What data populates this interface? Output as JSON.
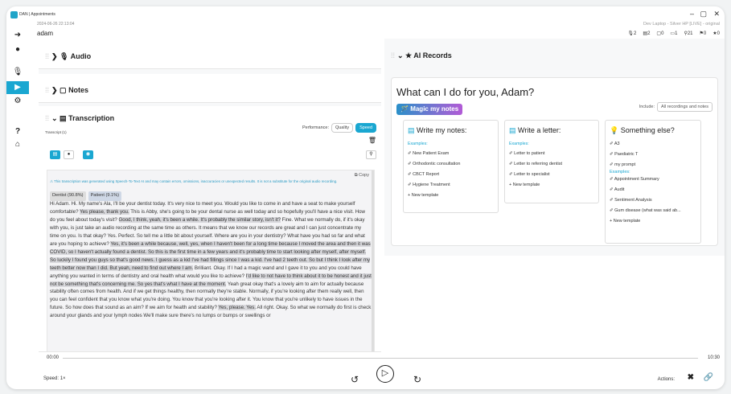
{
  "window": {
    "app_title": "DAN | Appointments",
    "date": "2024-06-26 22:13:04",
    "patient_name": "adam",
    "device": "Dev Laptop - Silver HP [LIVE] - original",
    "controls": {
      "minimize": "–",
      "maximize": "▢",
      "close": "✕"
    },
    "stats": [
      "2",
      "2",
      "0",
      "1",
      "21",
      "0",
      "0"
    ]
  },
  "nav": {
    "icons": [
      "arrow-icon",
      "person-icon",
      "mic-icon",
      "play-icon",
      "settings-icon",
      "help-icon",
      "home-icon"
    ]
  },
  "left": {
    "audio_label": "Audio",
    "notes_label": "Notes",
    "transcription_label": "Transcription",
    "transcript_sub": "Transcript (1)",
    "performance": {
      "label": "Performance:",
      "options": [
        "Quality",
        "Speed"
      ],
      "selected": "Speed"
    },
    "copy_label": "Copy",
    "warning": "This transcription was generated using Speech-To-Text AI and may contain errors, omissions, inaccuracies or unexpected results. It is not a substitute for the original audio recording.",
    "speakers": [
      "Dentist (90.8%)",
      "Patient (9.1%)"
    ],
    "transcript_text_pre": "Hi Adam. Hi. My name's Ala, I'll be your dentist today. It's very nice to meet you. Would you like to come in and have a seat to make yourself comfortable? ",
    "h1": "Yes please, thank you.",
    "transcript_text_1": " This is Abby, she's going to be your dental nurse as well today and so hopefully you'll have a nice visit. How do you feel about today's visit? ",
    "h2": "Good, I think, yeah, it's been a while. It's probably the similar story, isn't it?",
    "transcript_text_2": " Fine. What we normally do, if it's okay with you, is just take an audio recording at the same time as others. It means that we know our records are great and I can just concentrate my time on you. Is that okay? Yes. Perfect. So tell me a little bit about yourself. Where are you in your dentistry? What have you had so far and what are you hoping to achieve? ",
    "h3": "Yes, it's been a while because, well, yes, when I haven't been for a long time because I moved the area and then it was COVID, so I haven't actually found a dentist. So this is the first time in a few years and it's probably time to start looking after myself, after myself. So luckily I found you guys so that's good news. I guess as a kid I've had fillings since I was a kid. I've had 2 teeth out. So but I think I look after my teeth better now than I did. But yeah, need to find out where I am.",
    "transcript_text_3": " Brilliant. Okay. If I had a magic wand and I gave it to you and you could have anything you wanted in terms of dentistry and oral health what would you like to achieve? ",
    "h4": "I'd like to not have to think about it to be honest and it just not be something that's concerning me. So yes that's what I have at the moment.",
    "transcript_text_4": " Yeah great okay that's a lovely aim to aim for actually because stability often comes from health. And if we get things healthy, then normally they're stable. Normally, if you're looking after them really well, then you can feel confident that you know what you're doing. You know that you're looking after it. You know that you're unlikely to have issues in the future. So how does that sound as an aim? If we aim for health and stability? ",
    "h5": "Yes, please. Yes.",
    "transcript_text_5": " All right. Okay. So what we normally do first is check around your glands and your lymph nodes We'll make sure there's no lumps or bumps or swellings or"
  },
  "right": {
    "ai_label": "AI Records",
    "prompt": "What can I do for you, Adam?",
    "magic_label": "Magic my notes",
    "include_label": "Include:",
    "include_value": "All recordings and notes",
    "cards": [
      {
        "title": "Write my notes:",
        "examples": "Examples:",
        "items": [
          "New Patient Exam",
          "Orthodontic consultation",
          "CBCT Report",
          "Hygiene Treatment",
          "+ New template"
        ]
      },
      {
        "title": "Write a letter:",
        "examples": "Examples:",
        "items": [
          "Letter to patient",
          "Letter to referring dentist",
          "Letter to specialist",
          "+ New template"
        ]
      },
      {
        "title": "Something else?",
        "items_top": [
          "A3",
          "Paediatric T",
          "my prompt"
        ],
        "examples": "Examples:",
        "items": [
          "Appointment Summary",
          "Audit",
          "Sentiment Analysis",
          "Gum disease (what was said ab...",
          "+ New template"
        ]
      }
    ]
  },
  "player": {
    "current": "00:00",
    "total": "10:30",
    "speed_label": "Speed:",
    "speed_value": "1×",
    "actions_label": "Actions:"
  },
  "colors": {
    "accent": "#1aa7d1",
    "highlight": "#d8d8dc",
    "magic_start": "#2a90c9",
    "magic_end": "#b25bd6"
  }
}
